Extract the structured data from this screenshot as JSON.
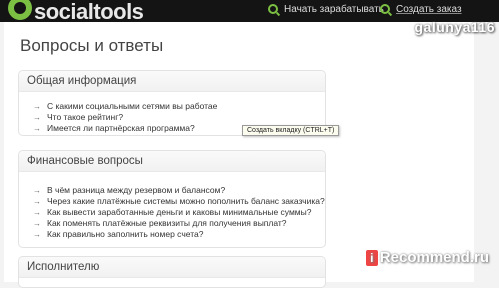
{
  "header": {
    "logo_text": "socialtools",
    "nav": [
      {
        "label": "Начать зарабатывать",
        "icon": "search-icon"
      },
      {
        "label": "Создать заказ",
        "icon": "search-icon"
      }
    ]
  },
  "watermark": {
    "username": "galunya116",
    "site": "Recommend.ru",
    "badge": "i"
  },
  "page": {
    "title": "Вопросы и ответы"
  },
  "sections": [
    {
      "title": "Общая информация",
      "questions": [
        "С какими социальными сетями вы работае",
        "Что такое рейтинг?",
        "Имеется ли партнёрская программа?"
      ]
    },
    {
      "title": "Финансовые вопросы",
      "questions": [
        "В чём разница между резервом и балансом?",
        "Через какие платёжные системы можно пополнить баланс заказчика?",
        "Как вывести заработанные деньги и каковы минимальные суммы?",
        "Как поменять платёжные реквизиты для получения выплат?",
        "Как правильно заполнить номер счета?"
      ]
    },
    {
      "title": "Исполнителю",
      "questions": []
    }
  ],
  "tooltip": {
    "text": "Создать вкладку (CTRL+T)"
  }
}
